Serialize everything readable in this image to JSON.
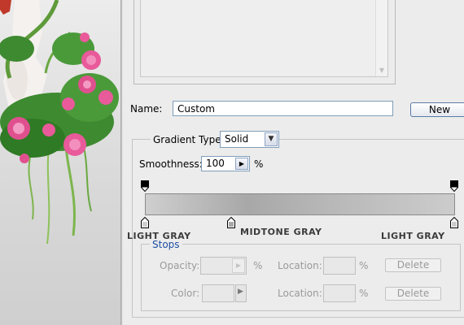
{
  "dialog": {
    "name_label": "Name:",
    "name_value": "Custom",
    "new_button": "New",
    "gradient_type_label": "Gradient Type:",
    "gradient_type_value": "Solid",
    "smoothness_label": "Smoothness:",
    "smoothness_value": "100",
    "smoothness_unit": "%"
  },
  "stop_labels": {
    "left": "LIGHT GRAY",
    "middle": "MIDTONE GRAY",
    "right": "LIGHT GRAY"
  },
  "stops": {
    "title": "Stops",
    "opacity_label": "Opacity:",
    "opacity_unit": "%",
    "color_label": "Color:",
    "location_label": "Location:",
    "location_unit": "%",
    "delete_label": "Delete"
  },
  "colors": {
    "gradient_left": "#cfcfcf",
    "gradient_mid": "#a8a8a8",
    "gradient_right": "#cccccc",
    "stops_title": "#1c4ea3"
  },
  "icons": [
    "chevron-down-icon",
    "chevron-right-icon",
    "color-stop-icon",
    "opacity-stop-icon"
  ]
}
